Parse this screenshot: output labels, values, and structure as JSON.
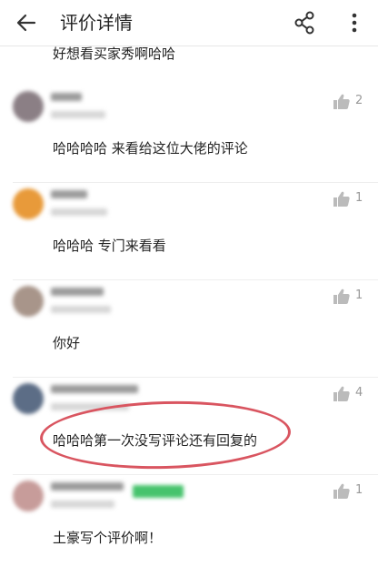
{
  "header": {
    "title": "评价详情",
    "back_icon": "arrow-left-icon",
    "share_icon": "share-icon",
    "more_icon": "more-vertical-icon"
  },
  "previous_comment_tail": "好想看买家秀啊哈哈",
  "comments": [
    {
      "text": "哈哈哈哈 来看给这位大佬的评论",
      "likes": "2",
      "avatar_color": "#8b7f85"
    },
    {
      "text": "哈哈哈 专门来看看",
      "likes": "1",
      "avatar_color": "#e89a3a"
    },
    {
      "text": "你好",
      "likes": "1",
      "avatar_color": "#a8958a"
    },
    {
      "text": "哈哈哈第一次没写评论还有回复的",
      "likes": "4",
      "avatar_color": "#5c6d86"
    },
    {
      "text": "土豪写个评价啊！",
      "likes": "1",
      "avatar_color": "#c79c9a"
    }
  ],
  "colors": {
    "annotation_ring": "#d95560",
    "like_icon": "#bbbbbb",
    "badge_green": "#46c36d"
  }
}
